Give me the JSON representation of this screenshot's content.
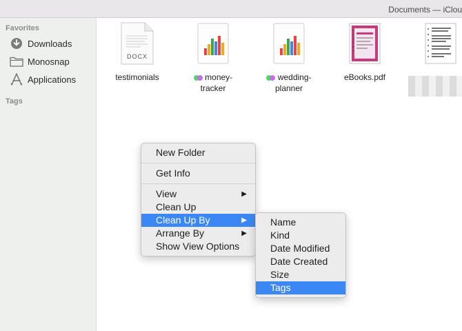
{
  "window": {
    "title": "Documents — iClou"
  },
  "sidebar": {
    "favorites_heading": "Favorites",
    "items": [
      {
        "label": "Downloads",
        "icon": "download-circle-icon"
      },
      {
        "label": "Monosnap",
        "icon": "folder-icon"
      },
      {
        "label": "Applications",
        "icon": "applications-icon"
      }
    ],
    "tags_heading": "Tags"
  },
  "files": [
    {
      "name": "testimonials",
      "icon": "docx-file-icon",
      "badge": "DOCX"
    },
    {
      "name_line1": "money-",
      "name_line2": "tracker",
      "icon": "numbers-chart-icon",
      "tag_colors": [
        "#4cd964",
        "#c86ee8"
      ]
    },
    {
      "name_line1": "wedding-",
      "name_line2": "planner",
      "icon": "numbers-chart-icon",
      "tag_colors": [
        "#4cd964",
        "#c86ee8"
      ]
    },
    {
      "name": "eBooks.pdf",
      "icon": "pdf-file-icon"
    },
    {
      "icon": "document-file-icon"
    }
  ],
  "context_menu": {
    "new_folder": "New Folder",
    "get_info": "Get Info",
    "view": "View",
    "clean_up": "Clean Up",
    "clean_up_by": "Clean Up By",
    "arrange_by": "Arrange By",
    "show_view_options": "Show View Options"
  },
  "submenu": {
    "name": "Name",
    "kind": "Kind",
    "date_modified": "Date Modified",
    "date_created": "Date Created",
    "size": "Size",
    "tags": "Tags"
  },
  "colors": {
    "selection": "#3b88f5",
    "sidebar_bg": "#eef0ee"
  }
}
